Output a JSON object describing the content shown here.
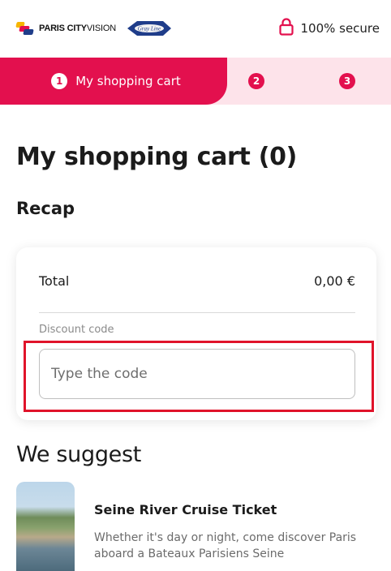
{
  "header": {
    "brand_bold": "PARIS CITY",
    "brand_light": "VISION",
    "partner_logo": "Gray Line",
    "secure_text": "100% secure",
    "icons": {
      "lock": "lock-icon"
    }
  },
  "steps": {
    "active_number": "1",
    "active_label": "My shopping cart",
    "step2": "2",
    "step3": "3"
  },
  "page": {
    "title": "My shopping cart (0)",
    "recap_title": "Recap"
  },
  "recap": {
    "total_label": "Total",
    "total_value": "0,00 €",
    "discount_label": "Discount code",
    "discount_placeholder": "Type the code",
    "discount_value": ""
  },
  "suggest": {
    "title": "We suggest",
    "items": [
      {
        "title": "Seine River Cruise Ticket",
        "description": "Whether it's day or night, come discover Paris aboard a Bateaux Parisiens Seine"
      }
    ]
  },
  "colors": {
    "brand_red": "#e3104e",
    "step_bar_bg": "#fde3ea",
    "highlight_border": "#e0132a"
  }
}
